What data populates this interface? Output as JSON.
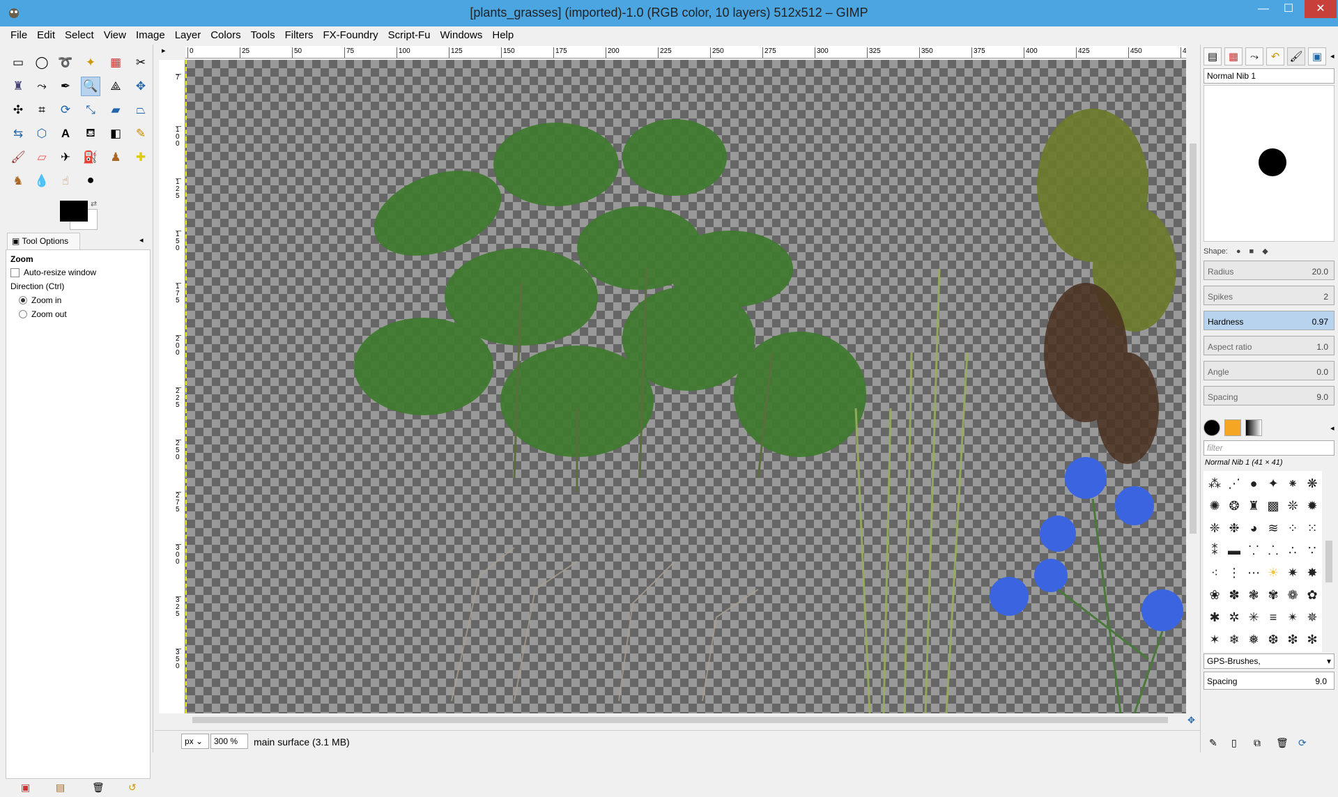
{
  "window": {
    "title": "[plants_grasses] (imported)-1.0 (RGB color, 10 layers) 512x512 – GIMP",
    "minimize": "—",
    "maximize": "☐",
    "close": "✕"
  },
  "menu": [
    "File",
    "Edit",
    "Select",
    "View",
    "Image",
    "Layer",
    "Colors",
    "Tools",
    "Filters",
    "FX-Foundry",
    "Script-Fu",
    "Windows",
    "Help"
  ],
  "toolbox": {
    "tool_options_tab": "Tool Options",
    "tool_name": "Zoom",
    "auto_resize": "Auto-resize window",
    "direction_label": "Direction  (Ctrl)",
    "zoom_in": "Zoom in",
    "zoom_out": "Zoom out"
  },
  "ruler": {
    "h_labels": [
      "0",
      "25",
      "50",
      "75",
      "100",
      "125",
      "150",
      "175",
      "200",
      "225",
      "250",
      "275",
      "300",
      "325",
      "350",
      "375",
      "400",
      "425",
      "450",
      "4"
    ],
    "v_labels": [
      "7",
      "1 0 0",
      "1 2 5",
      "1 5 0",
      "1 7 5",
      "2 0 0",
      "2 2 5",
      "2 5 0",
      "2 7 5",
      "3 0 0",
      "3 2 5",
      "3 5 0"
    ]
  },
  "status": {
    "unit": "px",
    "zoom": "300 %",
    "info": "main surface  (3.1 MB)"
  },
  "brushes": {
    "name": "Normal Nib 1",
    "shape_label": "Shape:",
    "params": [
      {
        "label": "Radius",
        "value": "20.0"
      },
      {
        "label": "Spikes",
        "value": "2"
      },
      {
        "label": "Hardness",
        "value": "0.97"
      },
      {
        "label": "Aspect ratio",
        "value": "1.0"
      },
      {
        "label": "Angle",
        "value": "0.0"
      },
      {
        "label": "Spacing",
        "value": "9.0"
      }
    ],
    "filter_placeholder": "filter",
    "info": "Normal Nib 1 (41 × 41)",
    "set": "GPS-Brushes,",
    "spacing_label": "Spacing",
    "spacing_value": "9.0"
  }
}
